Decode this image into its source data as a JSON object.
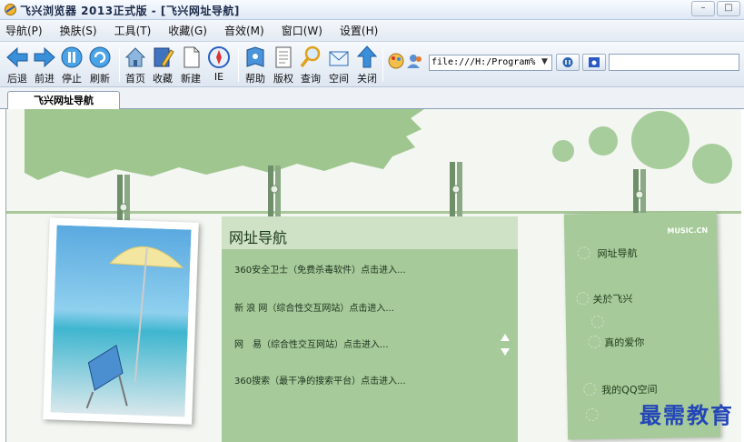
{
  "window": {
    "title": "飞兴浏览器 2013正式版 - [飞兴网址导航]",
    "controls": [
      "–",
      "□"
    ]
  },
  "menu": [
    "导航(P)",
    "换肤(S)",
    "工具(T)",
    "收藏(G)",
    "音效(M)",
    "窗口(W)",
    "设置(H)"
  ],
  "toolbar": {
    "back": "后退",
    "forward": "前进",
    "stop": "停止",
    "refresh": "刷新",
    "home": "首页",
    "favorites": "收藏",
    "new": "新建",
    "ie": "IE",
    "help": "帮助",
    "copyright": "版权",
    "query": "查询",
    "space": "空间",
    "close": "关闭"
  },
  "address": {
    "value": "file:///H:/Program%"
  },
  "tab": {
    "label": "飞兴网址导航"
  },
  "page": {
    "card_title": "网址导航",
    "links": [
      "360安全卫士（免费杀毒软件）点击进入...",
      "新 浪 网（综合性交互网站）点击进入...",
      "网　易（综合性交互网站）点击进入...",
      "360搜索（最干净的搜索平台）点击进入..."
    ],
    "music_badge": "MUSIC.CN",
    "side_menu": [
      "网址导航",
      "关於飞兴",
      "真的爱你",
      "我的QQ空间"
    ]
  },
  "watermark": "最需教育",
  "colors": {
    "accent_green": "#a6ca99",
    "dark_green": "#7fae6f",
    "titlebar": "#dfe9f6"
  }
}
